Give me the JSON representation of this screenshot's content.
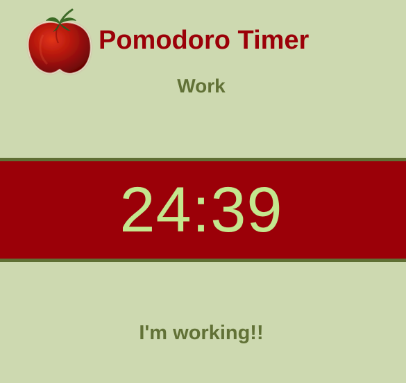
{
  "app": {
    "title": "Pomodoro Timer",
    "logo_icon": "tomato-icon"
  },
  "session": {
    "mode": "Work"
  },
  "timer": {
    "display": "24:39"
  },
  "status": {
    "message": "I'm working!!"
  },
  "colors": {
    "background": "#cdd9b0",
    "accent_red": "#9b0008",
    "olive_text": "#617136",
    "timer_text": "#c4e78e"
  }
}
